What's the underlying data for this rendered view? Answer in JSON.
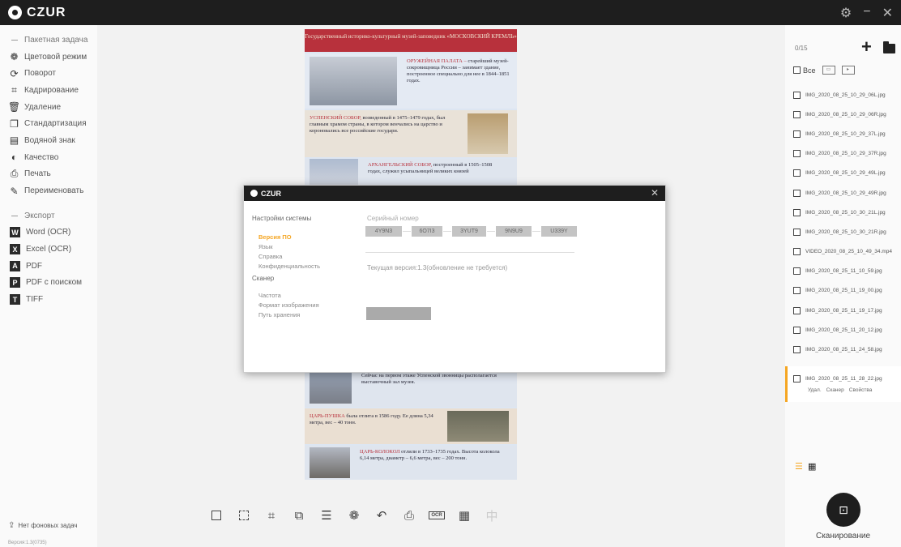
{
  "app": {
    "logo_text": "CZUR"
  },
  "window_controls": {
    "settings": "⚙",
    "minimize": "−",
    "close": "✕"
  },
  "sidebar": {
    "batch_header": "Пакетная задача",
    "items": [
      {
        "label": "Цветовой режим",
        "icon": "palette-icon",
        "glyph": "❁"
      },
      {
        "label": "Поворот",
        "icon": "rotate-icon",
        "glyph": "⟳"
      },
      {
        "label": "Кадрирование",
        "icon": "crop-icon",
        "glyph": "⌗"
      },
      {
        "label": "Удаление",
        "icon": "trash-icon",
        "glyph": "🗑"
      },
      {
        "label": "Стандартизация",
        "icon": "standardize-icon",
        "glyph": "❐"
      },
      {
        "label": "Водяной знак",
        "icon": "watermark-icon",
        "glyph": "▤"
      },
      {
        "label": "Качество",
        "icon": "quality-icon",
        "glyph": "◐"
      },
      {
        "label": "Печать",
        "icon": "print-icon",
        "glyph": "⎙"
      },
      {
        "label": "Переименовать",
        "icon": "rename-icon",
        "glyph": "✎"
      }
    ],
    "export_header": "Экспорт",
    "exports": [
      {
        "label": "Word (OCR)",
        "badge": "W"
      },
      {
        "label": "Excel (OCR)",
        "badge": "X"
      },
      {
        "label": "PDF",
        "badge": "A"
      },
      {
        "label": "PDF с поиском",
        "badge": "P"
      },
      {
        "label": "TIFF",
        "badge": "T"
      }
    ],
    "bg_tasks": "Нет фоновых задач",
    "version": "Версия:1.3(0735)"
  },
  "document": {
    "header": "Государственный историко-культурный музей-заповедник «МОСКОВСКИЙ КРЕМЛЬ»",
    "sections": [
      {
        "title": "ОРУЖЕЙНАЯ ПАЛАТА –",
        "text": "старейший музей-сокровищница России – занимает здание, построенное специально для нее в 1844–1851 годах."
      },
      {
        "title": "УСПЕНСКИЙ СОБОР,",
        "text": "возведенный в 1475–1479 годах, был главным храмом страны, в котором венчались на царство и короновались все российские государи."
      },
      {
        "title": "АРХАНГЕЛЬСКИЙ СОБОР,",
        "text": "построенный в 1505–1508 годах, служил усыпальницей великих князей"
      },
      {
        "title": "",
        "text": "ВЕЛИКОГО складывался на протяжении XVI–XVII веков. Сейчас на первом этаже Успенской звонницы располагается выставочный зал музея."
      },
      {
        "title": "ЦАРЬ-ПУШКА",
        "text": "была отлита в 1586 году. Ее длина 5,34 метра, вес – 40 тонн."
      },
      {
        "title": "ЦАРЬ-КОЛОКОЛ",
        "text": "отлили в 1733–1735 годах. Высота колокола 6,14 метра, диаметр – 6,6 метра, вес – 200 тонн."
      }
    ]
  },
  "dialog": {
    "title": "CZUR",
    "nav": {
      "system": "Настройки системы",
      "system_items": [
        "Версия ПО",
        "Язык",
        "Справка",
        "Конфиденциальность"
      ],
      "scanner": "Сканер",
      "scanner_items": [
        "Частота",
        "Формат изображения",
        "Путь хранения"
      ]
    },
    "serial_label": "Серийный номер",
    "serial_parts": [
      "4Y9N3",
      "6O7I3",
      "3YUT9",
      "9N9U9",
      "U339Y"
    ],
    "version_text": "Текущая версия:1.3(обновление не требуется)"
  },
  "files_panel": {
    "count": "0/15",
    "select_all": "Все",
    "files": [
      "IMG_2020_08_25_10_29_06L.jpg",
      "IMG_2020_08_25_10_29_06R.jpg",
      "IMG_2020_08_25_10_29_37L.jpg",
      "IMG_2020_08_25_10_29_37R.jpg",
      "IMG_2020_08_25_10_29_49L.jpg",
      "IMG_2020_08_25_10_29_49R.jpg",
      "IMG_2020_08_25_10_30_21L.jpg",
      "IMG_2020_08_25_10_30_21R.jpg",
      "VIDEO_2020_08_25_10_49_34.mp4",
      "IMG_2020_08_25_11_10_59.jpg",
      "IMG_2020_08_25_11_19_00.jpg",
      "IMG_2020_08_25_11_19_17.jpg",
      "IMG_2020_08_25_11_20_12.jpg",
      "IMG_2020_08_25_11_24_58.jpg"
    ],
    "active_file": "IMG_2020_08_25_11_28_22.jpg",
    "active_actions": [
      "Удал.",
      "Сканер",
      "Свойства"
    ],
    "scan_label": "Сканирование"
  },
  "toolbar": {
    "ocr_label": "OCR"
  },
  "colors": {
    "accent": "#f5a623",
    "titlebar": "#1e1e1e"
  }
}
